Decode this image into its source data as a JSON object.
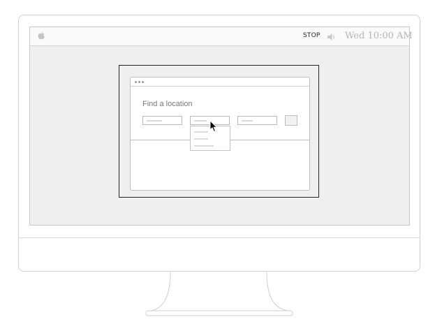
{
  "menubar": {
    "apple_icon": "apple-logo-icon",
    "stop_label": "STOP",
    "speaker_icon": "speaker-icon",
    "clock": "Wed 10:00 AM"
  },
  "browser": {
    "title": "Find a location",
    "fields": [
      {
        "name": "location-field-1"
      },
      {
        "name": "location-field-2",
        "has_dropdown": true
      },
      {
        "name": "location-field-3"
      }
    ],
    "dropdown_options": 3,
    "submit_button": "search-button"
  },
  "colors": {
    "screen_bg": "#efefef",
    "frame_border": "#222222",
    "clock_text": "#b5b5b5",
    "outline": "#cfcfcf"
  }
}
